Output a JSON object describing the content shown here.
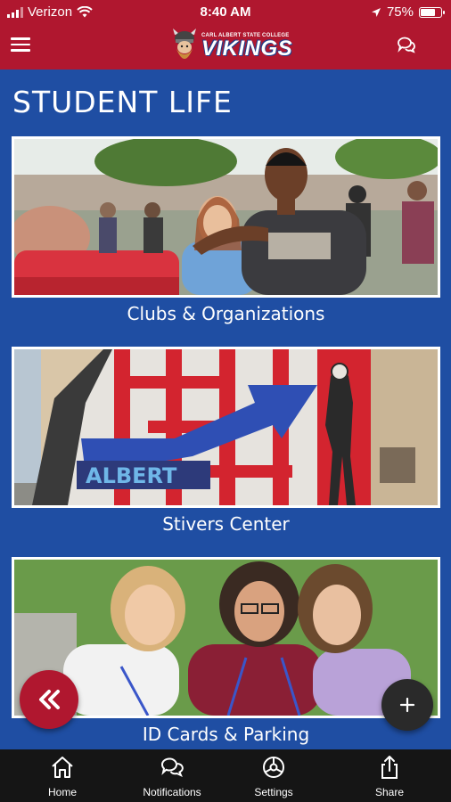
{
  "status_bar": {
    "carrier": "Verizon",
    "time": "8:40 AM",
    "battery": "75%",
    "battery_level": 0.75
  },
  "header": {
    "logo_subtitle": "CARL ALBERT STATE COLLEGE",
    "logo_title": "VIKINGS",
    "menu_icon": "hamburger-menu-icon",
    "chat_icon": "chat-icon"
  },
  "page": {
    "title": "STUDENT LIFE"
  },
  "cards": [
    {
      "label": "Clubs & Organizations"
    },
    {
      "label": "Stivers Center",
      "mural_text": "ALBERT"
    },
    {
      "label": "ID Cards & Parking"
    }
  ],
  "fabs": {
    "back_icon": "double-chevron-left-icon",
    "add_icon": "plus-icon"
  },
  "tabs": [
    {
      "label": "Home",
      "icon": "home-icon"
    },
    {
      "label": "Notifications",
      "icon": "chat-icon"
    },
    {
      "label": "Settings",
      "icon": "settings-icon"
    },
    {
      "label": "Share",
      "icon": "share-icon"
    }
  ],
  "colors": {
    "brand_red": "#b0172f",
    "background_blue": "#1f4ea3",
    "tabbar": "#151515"
  }
}
